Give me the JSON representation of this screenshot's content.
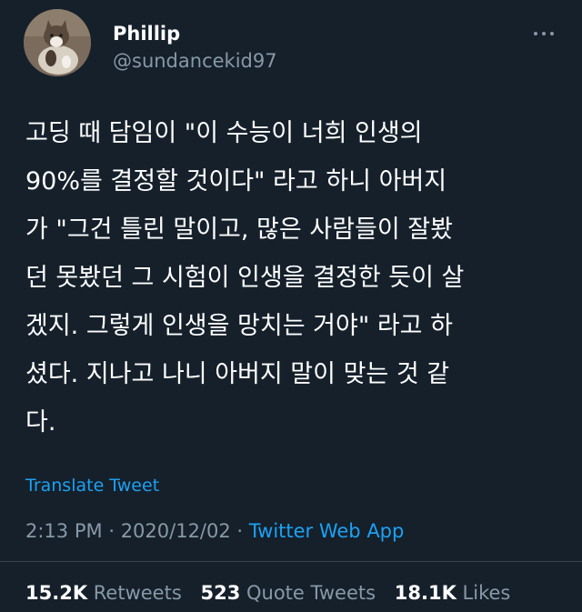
{
  "user": {
    "display_name": "Phillip",
    "username": "@sundancekid97",
    "avatar_icon": "cat-photo-avatar"
  },
  "more_icon": "more-options-icon",
  "tweet": {
    "lines": [
      "고딩 때 담임이 \"이 수능이 너희 인생의",
      "90%를 결정할 것이다\" 라고 하니 아버지",
      "가 \"그건 틀린 말이고, 많은 사람들이 잘봤",
      "던 못봤던 그 시험이 인생을 결정한 듯이 살",
      "겠지. 그렇게 인생을 망치는 거야\" 라고 하",
      "셨다. 지나고 나니 아버지 말이 맞는 것 같",
      "다."
    ]
  },
  "translate_label": "Translate Tweet",
  "meta": {
    "time": "2:13 PM",
    "separator": "·",
    "date": "2020/12/02",
    "source": "Twitter Web App"
  },
  "stats": {
    "retweets_count": "15.2K",
    "retweets_label": "Retweets",
    "quote_count": "523",
    "quote_label": "Quote Tweets",
    "likes_count": "18.1K",
    "likes_label": "Likes"
  },
  "colors": {
    "background": "#15202b",
    "text_primary": "#ffffff",
    "text_secondary": "#8899a6",
    "link": "#1da1f2",
    "divider": "#38444d"
  }
}
